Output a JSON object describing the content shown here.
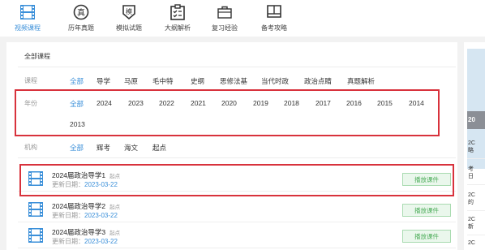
{
  "colors": {
    "accent": "#3a8fd9",
    "highlight_border": "#d8323c",
    "play_green": "#4fae5c"
  },
  "nav": {
    "items": [
      {
        "label": "视频课程",
        "icon": "film-icon",
        "active": true
      },
      {
        "label": "历年真题",
        "icon": "zhen-badge-icon",
        "active": false
      },
      {
        "label": "模拟试题",
        "icon": "mo-shield-icon",
        "active": false
      },
      {
        "label": "大纲解析",
        "icon": "checklist-icon",
        "active": false
      },
      {
        "label": "复习经验",
        "icon": "briefcase-icon",
        "active": false
      },
      {
        "label": "备考攻略",
        "icon": "book-icon",
        "active": false
      }
    ]
  },
  "section": {
    "title": "全部课程"
  },
  "filters": {
    "course": {
      "label": "课程",
      "options": [
        "全部",
        "导学",
        "马原",
        "毛中特",
        "史纲",
        "思修法基",
        "当代时政",
        "政治点睛",
        "真题解析"
      ]
    },
    "year": {
      "label": "年份",
      "options": [
        "全部",
        "2024",
        "2023",
        "2022",
        "2021",
        "2020",
        "2019",
        "2018",
        "2017",
        "2016",
        "2015",
        "2014",
        "2013"
      ]
    },
    "org": {
      "label": "机构",
      "options": [
        "全部",
        "辉考",
        "海文",
        "起点"
      ]
    }
  },
  "courses": [
    {
      "title": "2024届政治导学1",
      "tag": "起点",
      "date_label": "更新日期：",
      "date": "2023-03-22",
      "action": "播放课件"
    },
    {
      "title": "2024届政治导学2",
      "tag": "起点",
      "date_label": "更新日期：",
      "date": "2023-03-22",
      "action": "播放课件"
    },
    {
      "title": "2024届政治导学3",
      "tag": "起点",
      "date_label": "更新日期：",
      "date": "2023-03-22",
      "action": "播放课件"
    }
  ],
  "side": {
    "banner_text": "20",
    "lines": [
      "2C",
      "略",
      "考",
      "日",
      "2C",
      "的",
      "2C",
      "新",
      "2C"
    ]
  }
}
